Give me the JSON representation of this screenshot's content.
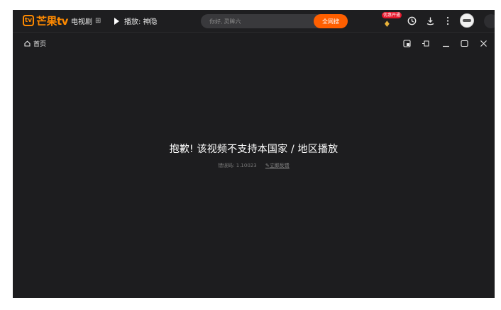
{
  "header": {
    "logo_text": "芒果tv",
    "logo_mark": "tv",
    "nav_tv_label": "电视剧",
    "now_playing_label": "播放: 神隐",
    "search": {
      "placeholder": "你好, 灵眸六",
      "button_label": "全网搜"
    },
    "vip_badge": "优惠开通",
    "icons": [
      "history-icon",
      "download-icon",
      "more-icon"
    ]
  },
  "subbar": {
    "home_label": "首页",
    "window_controls": [
      "pip-icon",
      "pin-icon",
      "minimize-icon",
      "maximize-icon",
      "close-icon"
    ]
  },
  "error": {
    "message": "抱歉! 该视频不支持本国家 / 地区播放",
    "code_text": "错误码: 1.10023",
    "feedback_label": "立即反馈"
  },
  "colors": {
    "accent": "#ff8a00",
    "search_button": "#ff5f00",
    "background": "#1d1d1f",
    "vip_red": "#e5162b"
  }
}
